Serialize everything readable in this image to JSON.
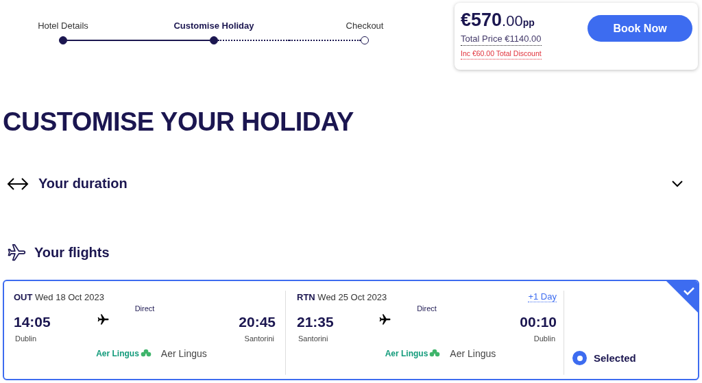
{
  "steps": [
    {
      "label": "Hotel Details",
      "selected": false
    },
    {
      "label": "Customise Holiday",
      "selected": true
    },
    {
      "label": "Checkout",
      "selected": false
    }
  ],
  "price": {
    "amount": "€570",
    "decimals": ".00",
    "unit": "pp",
    "total": "Total Price €1140.00",
    "discount": "Inc €60.00 Total Discount",
    "button": "Book Now"
  },
  "heading": "CUSTOMISE YOUR HOLIDAY",
  "duration": {
    "title": "Your duration",
    "expanded": false
  },
  "flights": {
    "title": "Your flights",
    "options": [
      {
        "selected": true,
        "status": "Selected",
        "legs": [
          {
            "direction": "OUT",
            "date": "Wed 18 Oct 2023",
            "stops": "Direct",
            "depart_time": "14:05",
            "arrive_time": "20:45",
            "from": "Dublin",
            "to": "Santorini",
            "airline_logo": "Aer Lingus",
            "airline": "Aer Lingus"
          },
          {
            "direction": "RTN",
            "date": "Wed 25 Oct 2023",
            "day_offset": "+1 Day",
            "stops": "Direct",
            "depart_time": "21:35",
            "arrive_time": "00:10",
            "from": "Santorini",
            "to": "Dublin",
            "airline_logo": "Aer Lingus",
            "airline": "Aer Lingus"
          }
        ]
      }
    ]
  }
}
